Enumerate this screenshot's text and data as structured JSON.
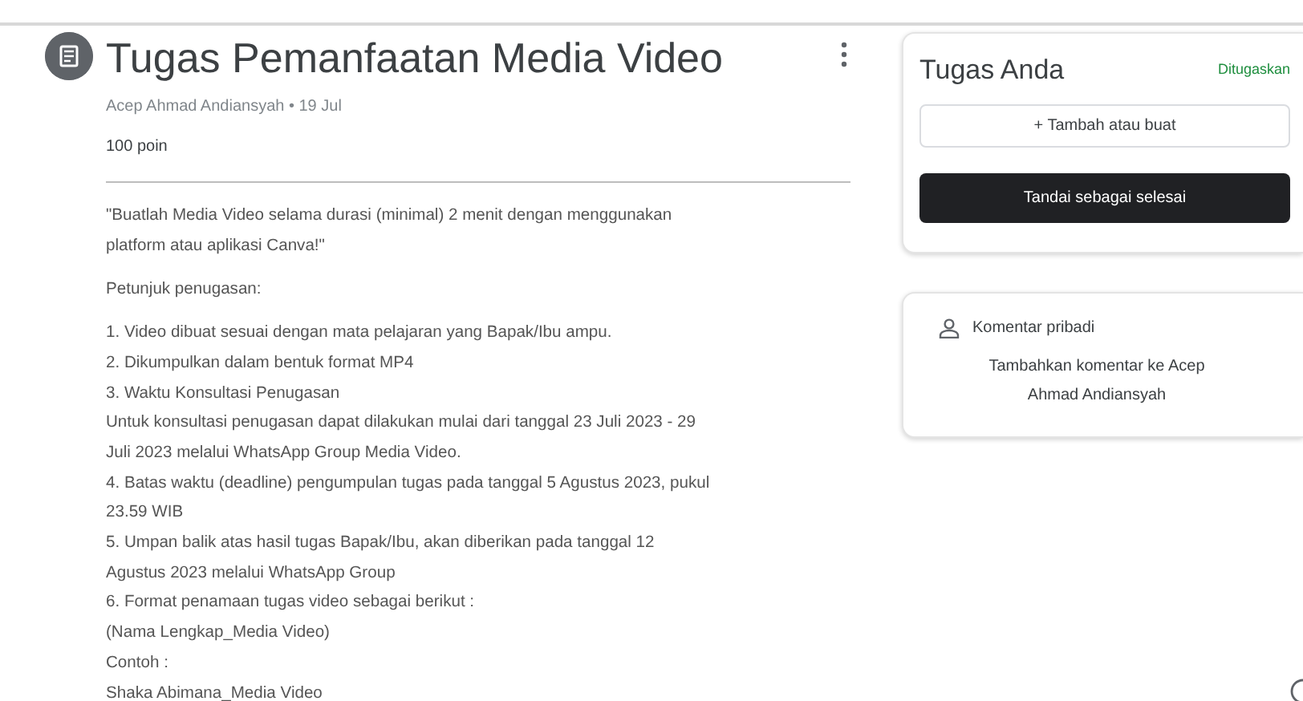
{
  "assignment": {
    "title": "Tugas Pemanfaatan Media Video",
    "meta": "Acep Ahmad Andiansyah • 19 Jul",
    "points": "100 poin",
    "description": [
      [
        "\"Buatlah Media Video selama durasi (minimal) 2 menit dengan menggunakan",
        "platform atau aplikasi Canva!\""
      ],
      [
        "Petunjuk penugasan:"
      ],
      [
        "1. Video dibuat sesuai dengan mata pelajaran yang Bapak/Ibu ampu.",
        "2. Dikumpulkan dalam bentuk format MP4",
        "3. Waktu Konsultasi Penugasan",
        "Untuk konsultasi penugasan dapat dilakukan mulai dari tanggal 23 Juli 2023 - 29",
        "Juli 2023 melalui WhatsApp Group Media Video.",
        "4. Batas waktu (deadline) pengumpulan tugas pada tanggal 5 Agustus 2023, pukul",
        "23.59 WIB",
        "5.  Umpan balik atas hasil tugas Bapak/Ibu, akan diberikan pada tanggal 12",
        "Agustus 2023 melalui  WhatsApp Group",
        "6. Format penamaan tugas video sebagai berikut :",
        "(Nama Lengkap_Media Video)",
        "Contoh :",
        "Shaka Abimana_Media Video"
      ]
    ]
  },
  "your_work": {
    "title": "Tugas Anda",
    "status": "Ditugaskan",
    "add_button": "+  Tambah atau buat",
    "done_button": "Tandai sebagai selesai"
  },
  "private_comments": {
    "title": "Komentar pribadi",
    "link": "Tambahkan komentar ke Acep Ahmad Andiansyah"
  }
}
